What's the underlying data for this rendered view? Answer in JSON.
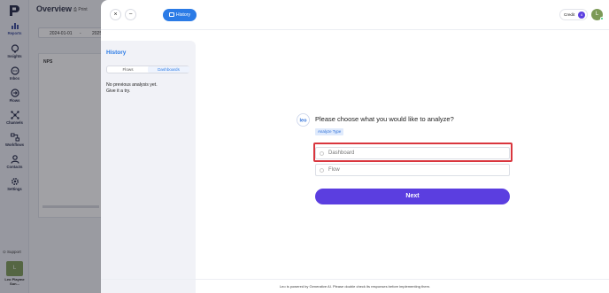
{
  "sidebar": {
    "items": [
      {
        "label": "Reports",
        "icon": "bar-chart-icon"
      },
      {
        "label": "Insights",
        "icon": "lightbulb-icon"
      },
      {
        "label": "Inbox",
        "icon": "chat-bubble-icon"
      },
      {
        "label": "Flows",
        "icon": "flow-icon"
      },
      {
        "label": "Channels",
        "icon": "channels-icon"
      },
      {
        "label": "Workflows",
        "icon": "workflow-icon"
      },
      {
        "label": "Contacts",
        "icon": "contact-icon"
      },
      {
        "label": "Settings",
        "icon": "gear-icon"
      }
    ],
    "support_label": "Support",
    "avatar_initial": "L",
    "user_name": "Leo Playme Son..."
  },
  "background_page": {
    "title": "Overview",
    "print_label": "Print",
    "date_start": "2024-01-01",
    "date_sep": "-",
    "date_end": "2025",
    "panel_label": "NPS"
  },
  "modal": {
    "history_button_label": "History",
    "credit_label": "Credit",
    "credit_count": "4",
    "user_initial": "L",
    "history_panel": {
      "title": "History",
      "tabs": [
        "Flows",
        "Dashboards"
      ],
      "active_tab": "Dashboards",
      "empty_line1": "No previous analysis yet.",
      "empty_line2": "Give it a try."
    },
    "question": "Please choose what you would like to analyze?",
    "analyze_type_badge": "Analyze Type",
    "options": [
      "Dashboard",
      "Flow"
    ],
    "next_label": "Next",
    "footer_text": "Leo is powered by Generative AI. Please double check its responses before implementing them."
  },
  "colors": {
    "accent_blue": "#2b7be6",
    "primary_purple": "#5b3ee0",
    "highlight_red": "#d9363e"
  }
}
